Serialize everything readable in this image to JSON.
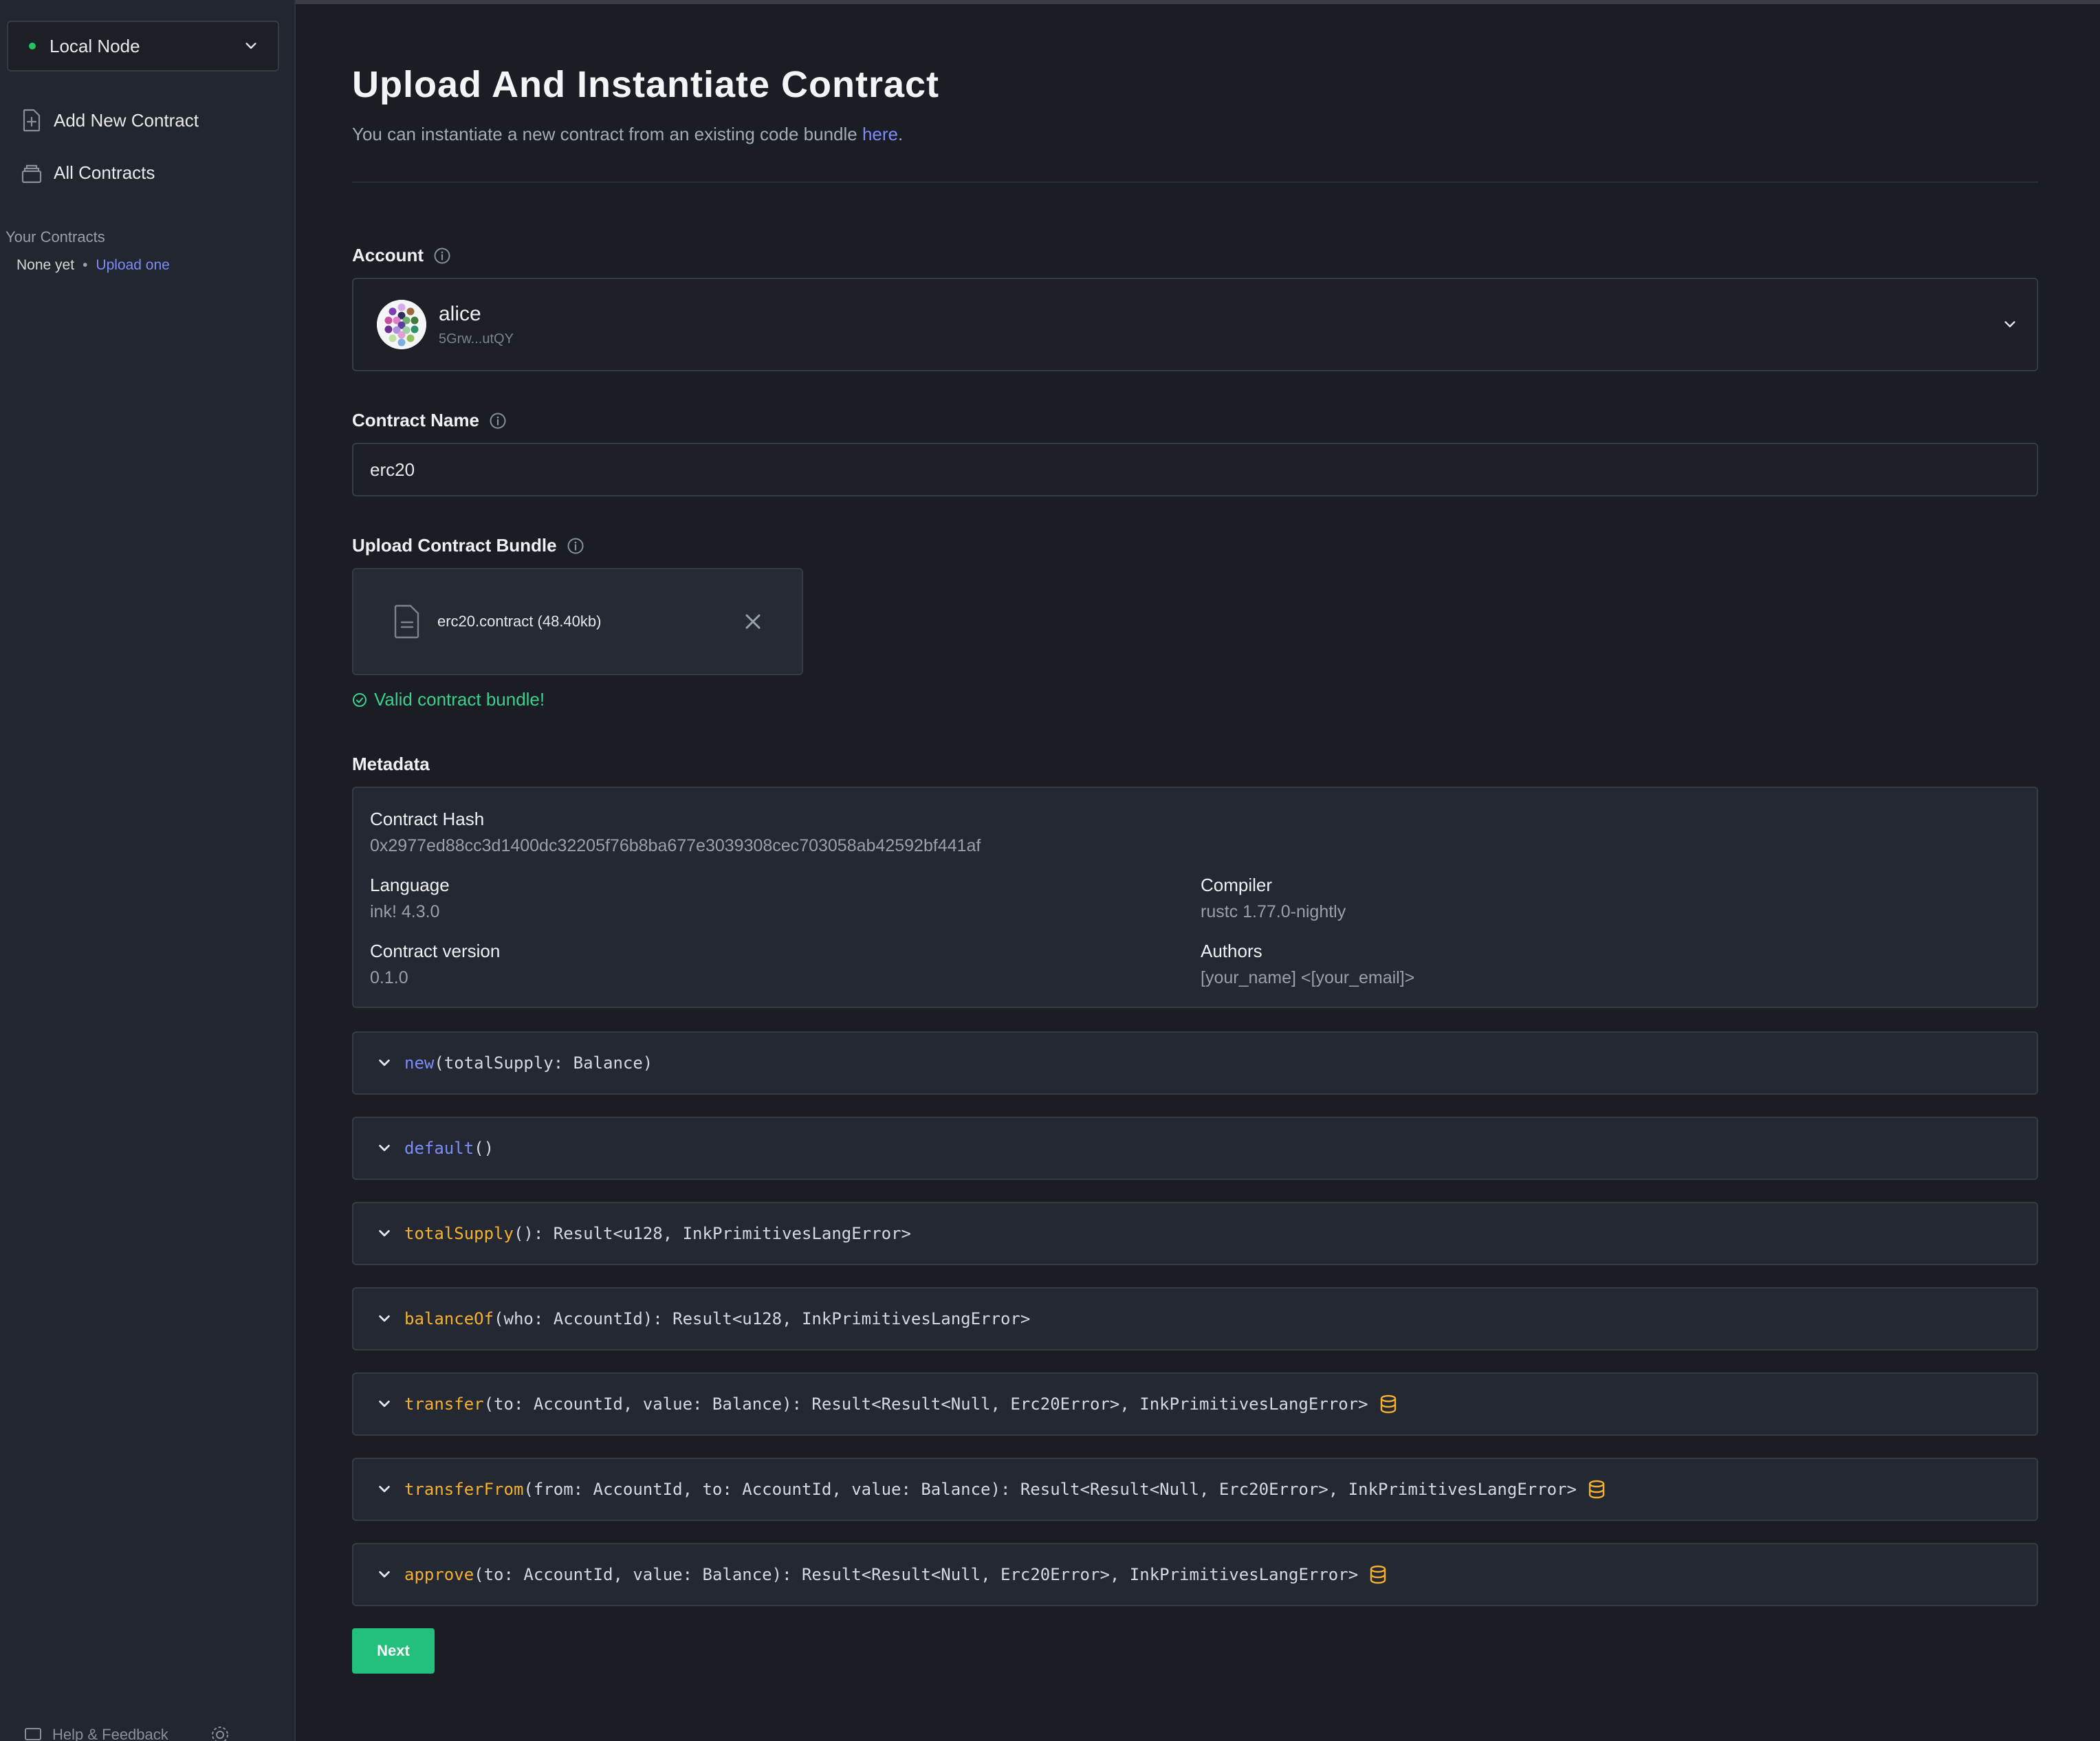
{
  "sidebar": {
    "node_selector": {
      "label": "Local Node",
      "status_color": "#22c55e"
    },
    "nav": [
      {
        "label": "Add New Contract",
        "icon": "file-plus-icon"
      },
      {
        "label": "All Contracts",
        "icon": "stack-icon"
      }
    ],
    "your_contracts": {
      "heading": "Your Contracts",
      "empty_text": "None yet",
      "upload_link": "Upload one"
    },
    "footer": {
      "help_label": "Help & Feedback",
      "settings_icon": "gear-icon"
    }
  },
  "page": {
    "title": "Upload And Instantiate Contract",
    "subtitle_prefix": "You can instantiate a new contract from an existing code bundle ",
    "subtitle_link": "here",
    "subtitle_suffix": "."
  },
  "account": {
    "label": "Account",
    "name": "alice",
    "address": "5Grw...utQY"
  },
  "contract_name": {
    "label": "Contract Name",
    "value": "erc20"
  },
  "bundle": {
    "label": "Upload Contract Bundle",
    "file_name": "erc20.contract (48.40kb)",
    "valid_message": "Valid contract bundle!"
  },
  "metadata": {
    "label": "Metadata",
    "contract_hash_label": "Contract Hash",
    "contract_hash": "0x2977ed88cc3d1400dc32205f76b8ba677e3039308cec703058ab42592bf441af",
    "language_label": "Language",
    "language": "ink! 4.3.0",
    "compiler_label": "Compiler",
    "compiler": "rustc 1.77.0-nightly",
    "version_label": "Contract version",
    "version": "0.1.0",
    "authors_label": "Authors",
    "authors": "[your_name] <[your_email]>"
  },
  "messages": [
    {
      "name": "new",
      "kind": "constructor",
      "signature": "(totalSupply: Balance)",
      "mutates": false
    },
    {
      "name": "default",
      "kind": "constructor",
      "signature": "()",
      "mutates": false
    },
    {
      "name": "totalSupply",
      "kind": "message",
      "signature": "(): Result<u128, InkPrimitivesLangError>",
      "mutates": false
    },
    {
      "name": "balanceOf",
      "kind": "message",
      "signature": "(who: AccountId): Result<u128, InkPrimitivesLangError>",
      "mutates": false
    },
    {
      "name": "transfer",
      "kind": "message",
      "signature": "(to: AccountId, value: Balance): Result<Result<Null, Erc20Error>, InkPrimitivesLangError>",
      "mutates": true
    },
    {
      "name": "transferFrom",
      "kind": "message",
      "signature": "(from: AccountId, to: AccountId, value: Balance): Result<Result<Null, Erc20Error>, InkPrimitivesLangError>",
      "mutates": true
    },
    {
      "name": "approve",
      "kind": "message",
      "signature": "(to: AccountId, value: Balance): Result<Result<Null, Erc20Error>, InkPrimitivesLangError>",
      "mutates": true
    }
  ],
  "actions": {
    "next_label": "Next"
  },
  "colors": {
    "accent_link": "#7c8cf8",
    "constructor_name": "#7c8cf8",
    "message_name": "#f5b12e",
    "success": "#3ccf8e",
    "primary_button": "#22c07a"
  }
}
